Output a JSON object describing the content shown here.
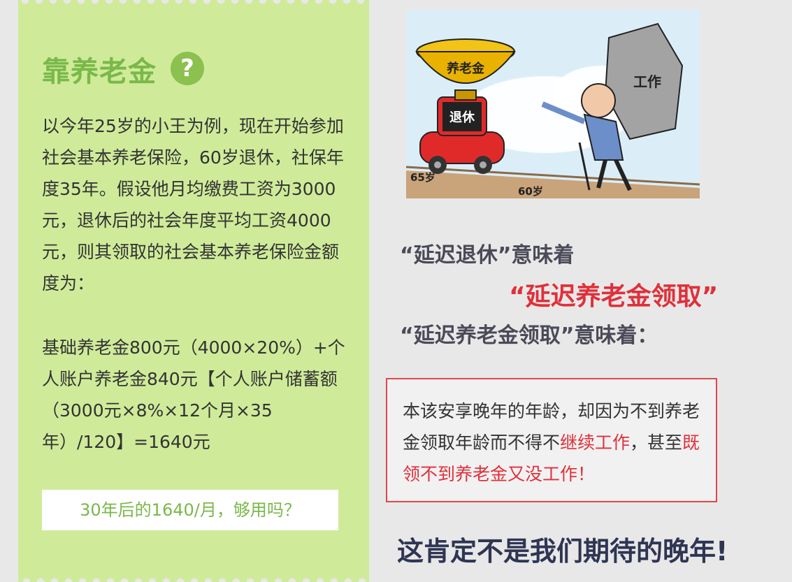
{
  "left_card": {
    "title": "靠养老金",
    "title_mark": "?",
    "para1": "以今年25岁的小王为例，现在开始参加社会基本养老保险，60岁退休，社保年度35年。假设他月均缴费工资为3000元，退休后的社会年度平均工资4000元，则其领取的社会基本养老保险金额度为：",
    "para2": "基础养老金800元（4000×20%）+个人账户养老金840元【个人账户储蓄额（3000元×8%×12个月×35年）/120】=1640元",
    "answer": "30年后的1640/月，够用吗？"
  },
  "cartoon": {
    "bowl_label": "养老金",
    "car_label": "退休",
    "rock_label": "工作",
    "age_65": "65岁",
    "age_60": "60岁"
  },
  "right": {
    "line1": "“延迟退休”意味着",
    "line2": "“延迟养老金领取”",
    "line3": "“延迟养老金领取”意味着：",
    "notice_a": "本该安享晚年的年龄，却因为不到养老金领取年龄而不得不",
    "notice_b": "继续工作",
    "notice_c": "，甚至",
    "notice_d": "既领不到养老金又没工作！",
    "bottom": "这肯定不是我们期待的晚年!"
  },
  "colors": {
    "card_bg": "#cfeb9a",
    "accent_green": "#7ab84a",
    "accent_red": "#e0303a",
    "dark_text": "#2f3553"
  }
}
